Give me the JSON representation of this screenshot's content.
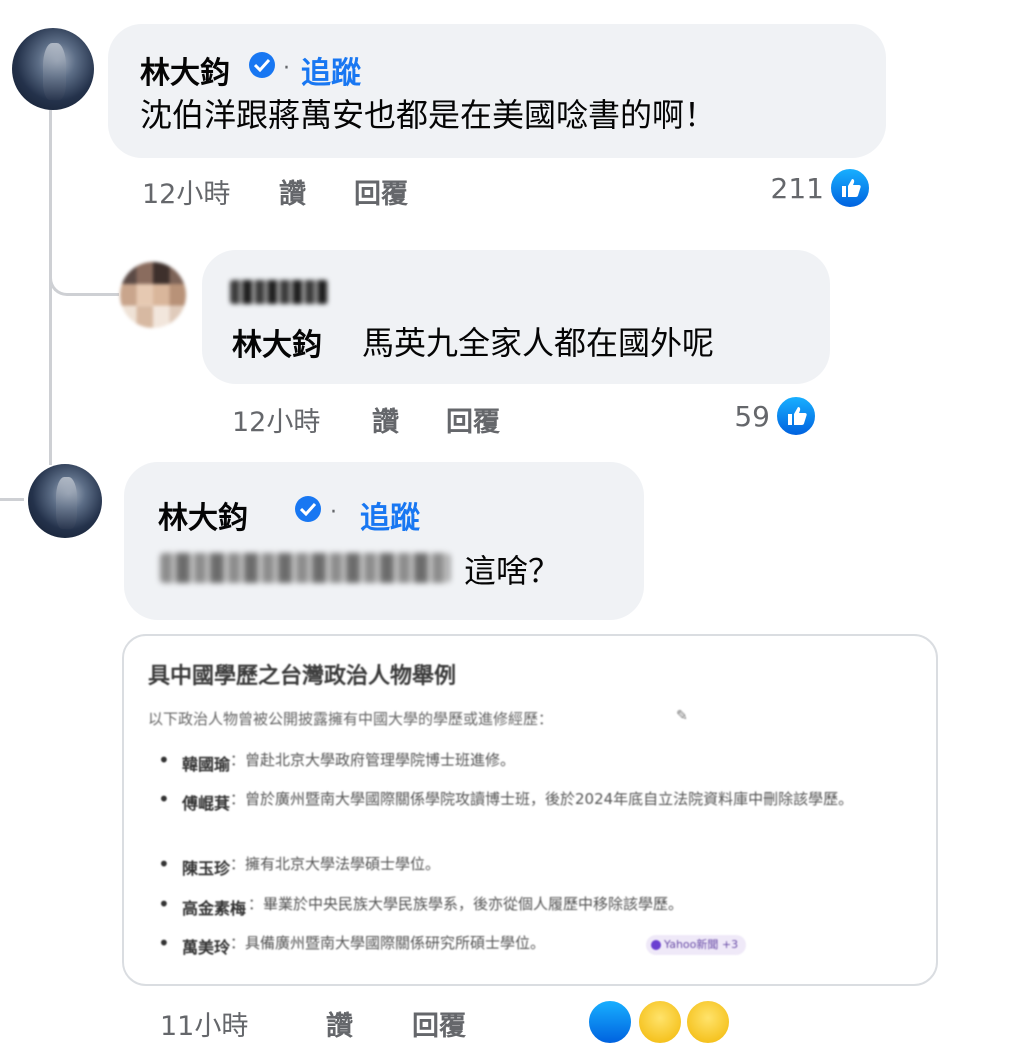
{
  "comment1": {
    "author": "林大鈞",
    "follow_label": "追蹤",
    "separator": "·",
    "text": "沈伯洋跟蔣萬安也都是在美國唸書的啊！",
    "time": "12小時",
    "like_label": "讚",
    "reply_label": "回覆",
    "reaction_count": "211"
  },
  "reply1": {
    "mention": "林大鈞",
    "text": "馬英九全家人都在國外呢",
    "time": "12小時",
    "like_label": "讚",
    "reply_label": "回覆",
    "reaction_count": "59"
  },
  "reply2": {
    "author": "林大鈞",
    "follow_label": "追蹤",
    "separator": "·",
    "text": "這啥？"
  },
  "attachment": {
    "title": "具中國學歷之台灣政治人物舉例",
    "intro": "以下政治人物曾被公開披露擁有中國大學的學歷或進修經歷：",
    "items": [
      {
        "name": "韓國瑜",
        "text": "：曾赴北京大學政府管理學院博士班進修。"
      },
      {
        "name": "傅崐萁",
        "text": "：曾於廣州暨南大學國際關係學院攻讀博士班，後於2024年底自立法院資料庫中刪除該學歷。"
      },
      {
        "name": "陳玉珍",
        "text": "：擁有北京大學法學碩士學位。"
      },
      {
        "name": "高金素梅",
        "text": "：畢業於中央民族大學民族學系，後亦從個人履歷中移除該學歷。"
      },
      {
        "name": "萬美玲",
        "text": "：具備廣州暨南大學國際關係研究所碩士學位。"
      }
    ],
    "source_label": "Yahoo新聞 +3"
  },
  "reply2_footer": {
    "time": "11小時",
    "like_label": "讚",
    "reply_label": "回覆"
  },
  "colors": {
    "link_blue": "#1877f2",
    "bubble_bg": "#f0f2f5",
    "meta_gray": "#65676b"
  }
}
